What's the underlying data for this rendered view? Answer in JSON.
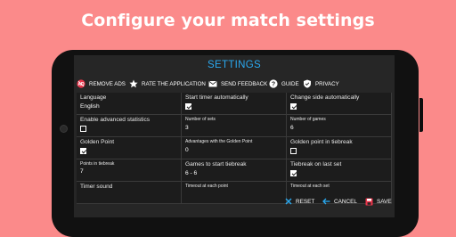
{
  "headline": "Configure your match settings",
  "screen_title": "SETTINGS",
  "menu": [
    {
      "icon": "no-ads-icon",
      "label": "REMOVE ADS"
    },
    {
      "icon": "star-icon",
      "label": "RATE THE APPLICATION"
    },
    {
      "icon": "mail-icon",
      "label": "SEND FEEDBACK"
    },
    {
      "icon": "help-icon",
      "label": "GUIDE"
    },
    {
      "icon": "shield-icon",
      "label": "PRIVACY"
    }
  ],
  "settings": {
    "language": {
      "label": "Language",
      "value": "English"
    },
    "start_timer": {
      "label": "Start timer automatically",
      "checked": true
    },
    "change_side": {
      "label": "Change side automatically",
      "checked": true
    },
    "advanced_stats": {
      "label": "Enable advanced statistics",
      "checked": false
    },
    "number_of_sets": {
      "label": "Number of sets",
      "value": "3"
    },
    "number_of_games": {
      "label": "Number of games",
      "value": "6"
    },
    "golden_point": {
      "label": "Golden Point",
      "checked": true
    },
    "advantages_golden": {
      "label": "Advantages with the Golden Point",
      "value": "0"
    },
    "golden_tiebreak": {
      "label": "Golden point in tiebreak",
      "checked": false
    },
    "points_tiebreak": {
      "label": "Points in tiebreak",
      "value": "7"
    },
    "games_tiebreak": {
      "label": "Games to start tiebreak",
      "value": "6 - 6"
    },
    "tiebreak_last_set": {
      "label": "Tiebreak on last set",
      "checked": true
    },
    "timer_sound": {
      "label": "Timer sound"
    },
    "timeout_point_1": {
      "label": "Timeout at each point"
    },
    "timeout_set": {
      "label": "Timeout at each set"
    }
  },
  "footer": {
    "reset": "RESET",
    "cancel": "CANCEL",
    "save": "SAVE"
  },
  "colors": {
    "background": "#fb8a8a",
    "accent": "#2aa9f0",
    "save_icon": "#e8344a"
  }
}
